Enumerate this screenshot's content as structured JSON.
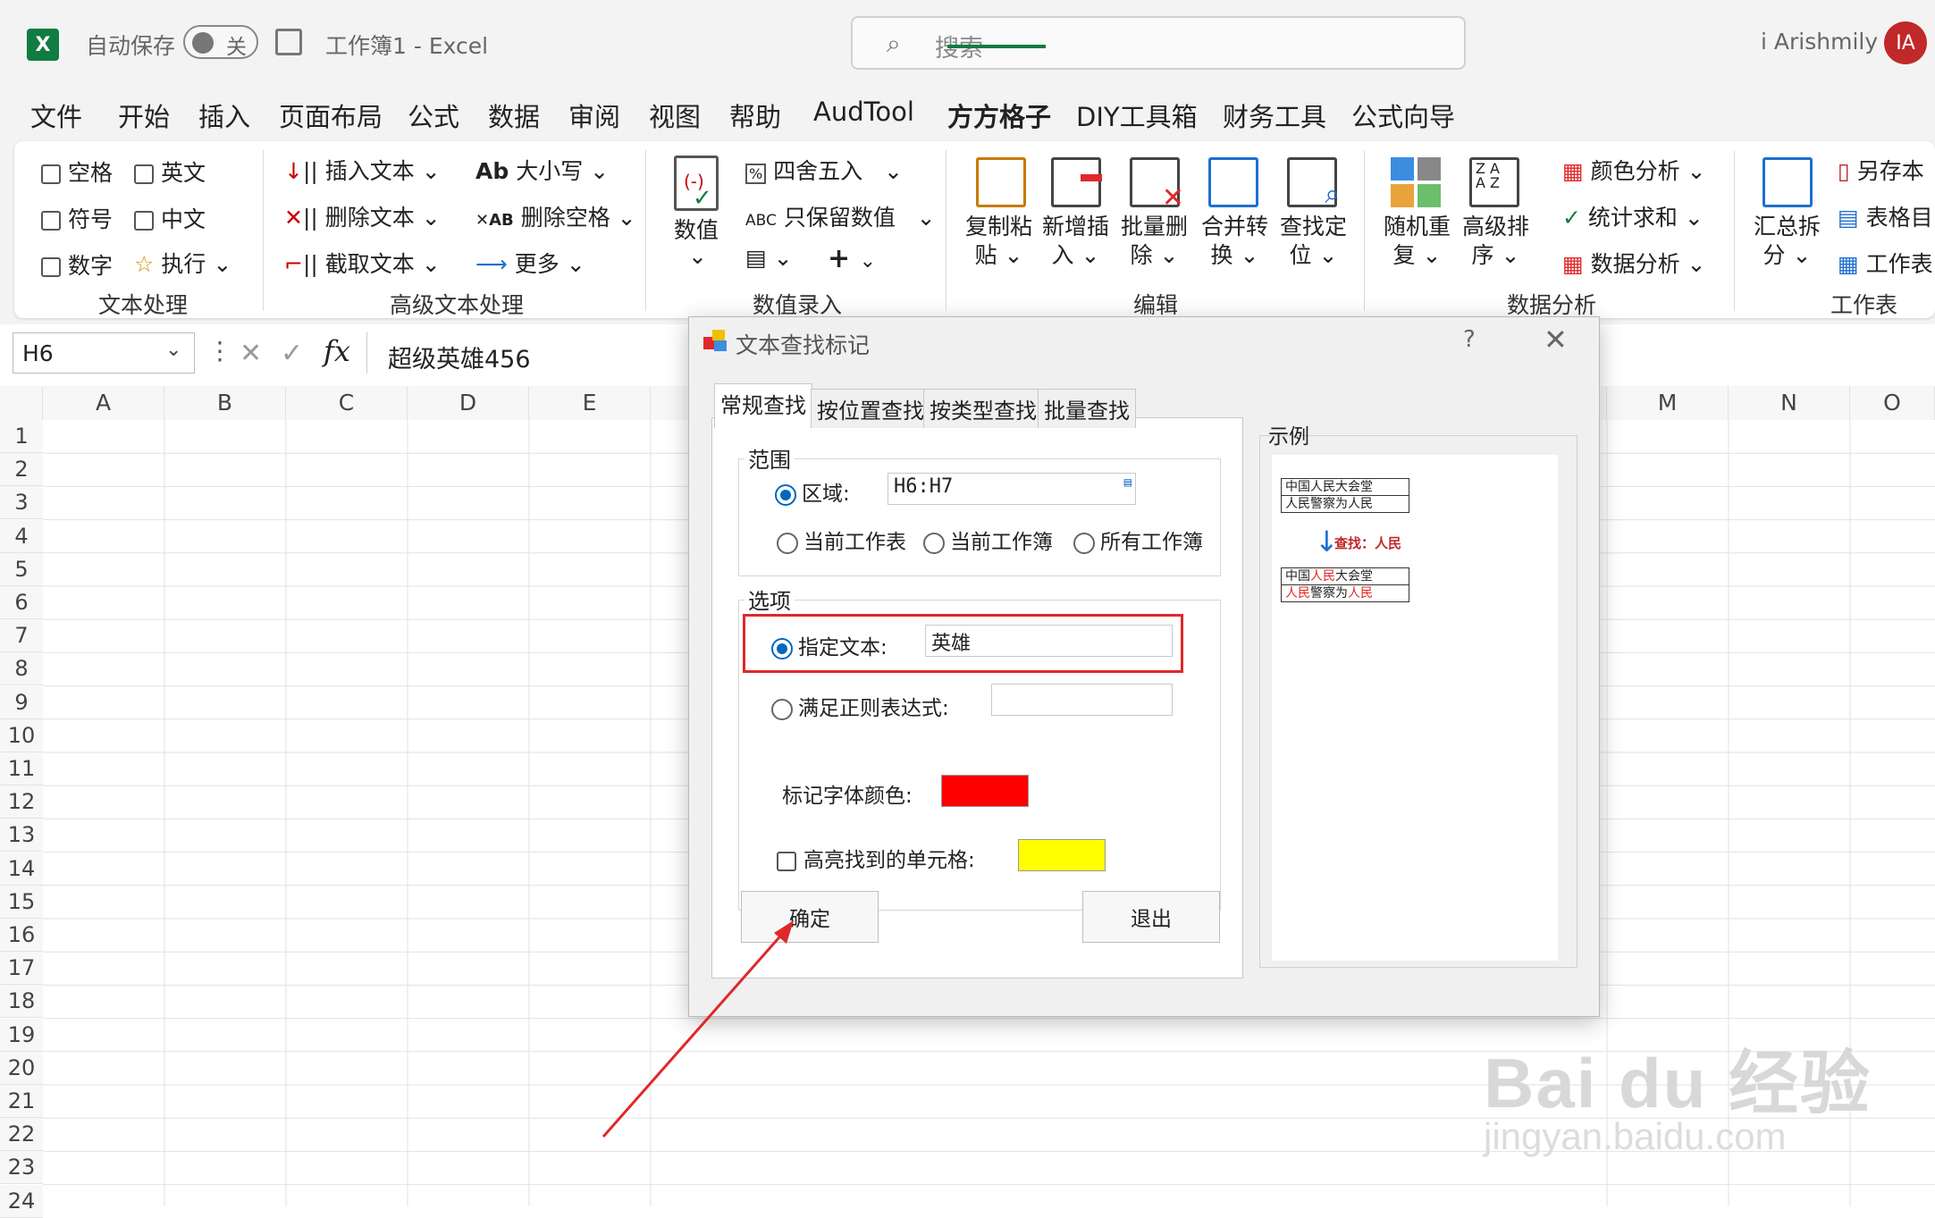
{
  "titlebar": {
    "logo": "X",
    "autosave_label": "自动保存",
    "autosave_state": "关",
    "doc_title": "工作簿1  -  Excel",
    "search_placeholder": "搜索",
    "user_name": "i Arishmily",
    "user_initials": "IA"
  },
  "menu": {
    "items": [
      "文件",
      "开始",
      "插入",
      "页面布局",
      "公式",
      "数据",
      "审阅",
      "视图",
      "帮助",
      "AudTool",
      "方方格子",
      "DIY工具箱",
      "财务工具",
      "公式向导"
    ],
    "active": "方方格子"
  },
  "ribbon": {
    "text_group": {
      "checks": [
        "空格",
        "英文",
        "符号",
        "中文",
        "数字"
      ],
      "execute": "执行",
      "label": "文本处理"
    },
    "adv_text_group": {
      "insert": "插入文本",
      "delete": "删除文本",
      "extract": "截取文本",
      "case": "大小写",
      "trim": "删除空格",
      "more": "更多",
      "label": "高级文本处理"
    },
    "num_group": {
      "value": "数值",
      "round": "四舍五入",
      "keep_num": "只保留数值",
      "abc": "ABC",
      "label": "数值录入"
    },
    "edit_group": {
      "items": [
        "复制粘贴",
        "新增插入",
        "批量删除",
        "合并转换",
        "查找定位"
      ],
      "items_l1": [
        "复制粘",
        "新增插",
        "批量删",
        "合并转",
        "查找定"
      ],
      "items_l2": [
        "贴",
        "入",
        "除",
        "换",
        "位"
      ],
      "label": "编辑"
    },
    "analysis_group": {
      "random_l1": "随机重",
      "random_l2": "复",
      "sort_l1": "高级排",
      "sort_l2": "序",
      "color": "颜色分析",
      "sum": "统计求和",
      "data": "数据分析",
      "label": "数据分析"
    },
    "sheet_group": {
      "split_l1": "汇总拆",
      "split_l2": "分",
      "save_as": "另存本",
      "table_dir": "表格目",
      "sheet": "工作表",
      "label": "工作表"
    }
  },
  "formula_bar": {
    "cell_ref": "H6",
    "fx": "fx",
    "formula": "超级英雄456"
  },
  "grid": {
    "columns": [
      "A",
      "B",
      "C",
      "D",
      "E",
      "M",
      "N",
      "O"
    ],
    "rows": [
      "1",
      "2",
      "3",
      "4",
      "5",
      "6",
      "7",
      "8",
      "9",
      "10",
      "11",
      "12",
      "13",
      "14",
      "15",
      "16",
      "17",
      "18",
      "19",
      "20",
      "21",
      "22",
      "23",
      "24"
    ]
  },
  "dialog": {
    "title": "文本查找标记",
    "help": "?",
    "close": "✕",
    "tabs": [
      "常规查找",
      "按位置查找",
      "按类型查找",
      "批量查找"
    ],
    "scope": {
      "legend": "范围",
      "region_label": "区域:",
      "region_value": "H6:H7",
      "sheet": "当前工作表",
      "book": "当前工作簿",
      "all": "所有工作簿"
    },
    "options": {
      "legend": "选项",
      "text_label": "指定文本:",
      "text_value": "英雄",
      "regex_label": "满足正则表达式:",
      "regex_value": "",
      "font_color_label": "标记字体颜色:",
      "font_color": "#ff0000"
    },
    "highlight_label": "高亮找到的单元格:",
    "highlight_color": "#ffff00",
    "ok": "确定",
    "exit": "退出",
    "example": {
      "legend": "示例",
      "before": [
        "中国人民大会堂",
        "人民警察为人民"
      ],
      "search_hint": "查找：人民",
      "after_row1": [
        "中国",
        "人民",
        "大会堂"
      ],
      "after_row2": [
        "人民",
        "警察为",
        "人民"
      ]
    }
  },
  "watermark": {
    "brand": "Bai  du 经验",
    "url": "jingyan.baidu.com"
  }
}
